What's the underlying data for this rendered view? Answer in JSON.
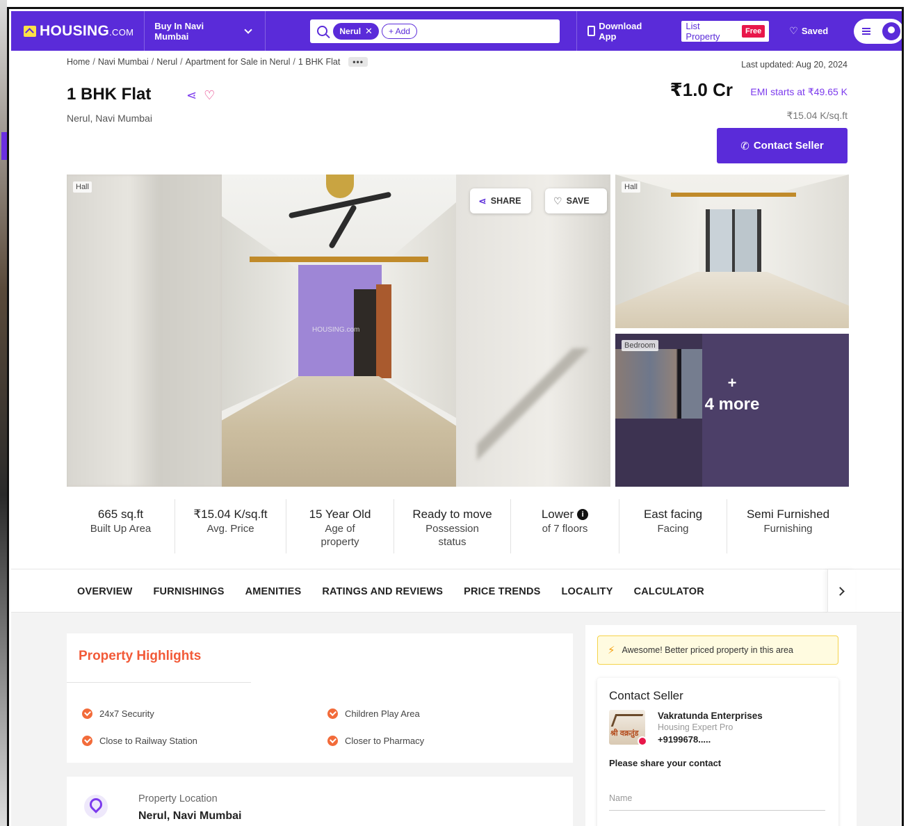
{
  "header": {
    "logo_main": "HOUSING",
    "logo_suffix": ".COM",
    "city_selector": "Buy In Navi Mumbai",
    "search_chip": "Nerul",
    "search_add": "+ Add",
    "download_app": "Download App",
    "list_property": "List Property",
    "free_badge": "Free",
    "saved": "Saved"
  },
  "breadcrumb": {
    "items": [
      "Home",
      "Navi Mumbai",
      "Nerul",
      "Apartment for Sale in Nerul",
      "1 BHK Flat"
    ],
    "more": "•••"
  },
  "listing": {
    "last_updated": "Last updated: Aug 20, 2024",
    "title": "1 BHK Flat",
    "locality": "Nerul, Navi Mumbai",
    "price": "₹1.0 Cr",
    "emi": "EMI starts at ₹49.65 K",
    "price_per_sqft": "₹15.04 K/sq.ft",
    "contact_button": "Contact Seller"
  },
  "gallery": {
    "main_tag": "Hall",
    "share": "SHARE",
    "save": "SAVE",
    "thumb1_tag": "Hall",
    "thumb2_tag": "Bedroom",
    "more_plus": "+",
    "more_label": "4 more",
    "watermark": "HOUSING.com"
  },
  "stats": [
    {
      "value": "665 sq.ft",
      "label": "Built Up Area"
    },
    {
      "value": "₹15.04 K/sq.ft",
      "label": "Avg. Price"
    },
    {
      "value": "15 Year Old",
      "label": "Age of property"
    },
    {
      "value": "Ready to move",
      "label": "Possession status"
    },
    {
      "value": "Lower",
      "label": "of 7 floors"
    },
    {
      "value": "East facing",
      "label": "Facing"
    },
    {
      "value": "Semi Furnished",
      "label": "Furnishing"
    }
  ],
  "tabs": [
    "OVERVIEW",
    "FURNISHINGS",
    "AMENITIES",
    "RATINGS AND REVIEWS",
    "PRICE TRENDS",
    "LOCALITY",
    "CALCULATOR"
  ],
  "highlights": {
    "title": "Property Highlights",
    "items": [
      "24x7 Security",
      "Children Play Area",
      "Close to Railway Station",
      "Closer to Pharmacy"
    ]
  },
  "location": {
    "label": "Property Location",
    "value": "Nerul, Navi Mumbai"
  },
  "sidebar": {
    "better_price": "Awesome! Better priced property in this area",
    "contact_title": "Contact Seller",
    "logo_text": "श्री वक्रतुंड",
    "seller_name": "Vakratunda Enterprises",
    "seller_role": "Housing Expert Pro",
    "seller_phone": "+9199678.....",
    "share_prompt": "Please share your contact",
    "name_placeholder": "Name"
  },
  "colors": {
    "brand": "#5a2bd9",
    "highlight_title": "#f25a38",
    "free_badge": "#e8174a"
  }
}
